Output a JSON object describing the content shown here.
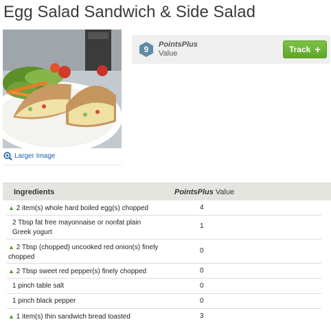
{
  "page": {
    "title": "Egg Salad Sandwich & Side Salad"
  },
  "image": {
    "larger_label": "Larger Image"
  },
  "points": {
    "value": "9",
    "label_brand": "PointsPlus",
    "label_suffix": "Value",
    "track_label": "Track",
    "track_plus": "+"
  },
  "colors": {
    "track_green": "#6ab335",
    "badge_blue": "#5e8aa3",
    "arrow_green": "#4c9a2a",
    "link_blue": "#1a5fa8"
  },
  "icons": {
    "zoom": "zoom-in-icon",
    "badge": "points-badge-icon",
    "plus": "plus-icon",
    "arrow": "triangle-up-icon"
  },
  "ingredients": {
    "header_name": "Ingredients",
    "header_points_brand": "PointsPlus",
    "header_points_suffix": "Value",
    "rows": [
      {
        "arrow": "▲",
        "name": "2 item(s) whole hard boiled egg(s) chopped",
        "points": "4"
      },
      {
        "arrow": "",
        "name": "2 Tbsp fat free mayonnaise or nonfat plain Greek yogurt",
        "points": "1"
      },
      {
        "arrow": "▲",
        "name": "2 Tbsp (chopped) uncooked red onion(s) finely chopped",
        "points": "0"
      },
      {
        "arrow": "▲",
        "name": "2 Tbsp sweet red pepper(s) finely chopped",
        "points": "0"
      },
      {
        "arrow": "",
        "name": "1 pinch table salt",
        "points": "0"
      },
      {
        "arrow": "",
        "name": "1 pinch black pepper",
        "points": "0"
      },
      {
        "arrow": "▲",
        "name": "1 item(s) thin sandwich bread toasted",
        "points": "3"
      }
    ]
  }
}
